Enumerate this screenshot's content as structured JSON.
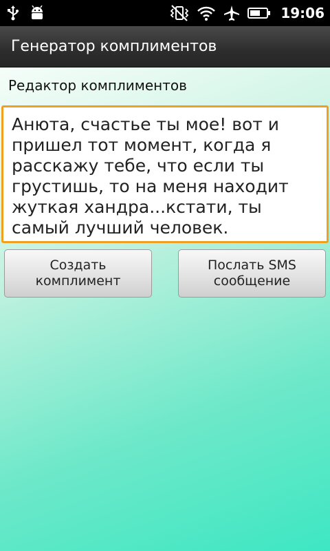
{
  "status_bar": {
    "time": "19:06",
    "icons_left": [
      "usb-icon",
      "android-debug-icon"
    ],
    "icons_right": [
      "mute-vibrate-icon",
      "wifi-icon",
      "airplane-mode-icon",
      "battery-icon"
    ]
  },
  "app": {
    "title": "Генератор комплиментов"
  },
  "editor": {
    "label": "Редактор комплиментов",
    "text": "Анюта, счастье ты мое! вот и пришел тот момент, когда я расскажу тебе, что если ты грустишь, то на меня находит жуткая хандра...кстати, ты самый лучший человек."
  },
  "buttons": {
    "create_label": "Создать комплимент",
    "send_label": "Послать SMS сообщение"
  },
  "colors": {
    "status_bar": "#000000",
    "title_bar": "#2d2d2d",
    "editor_focus_border": "#f0a020",
    "background_accent": "#3ee7c3"
  }
}
